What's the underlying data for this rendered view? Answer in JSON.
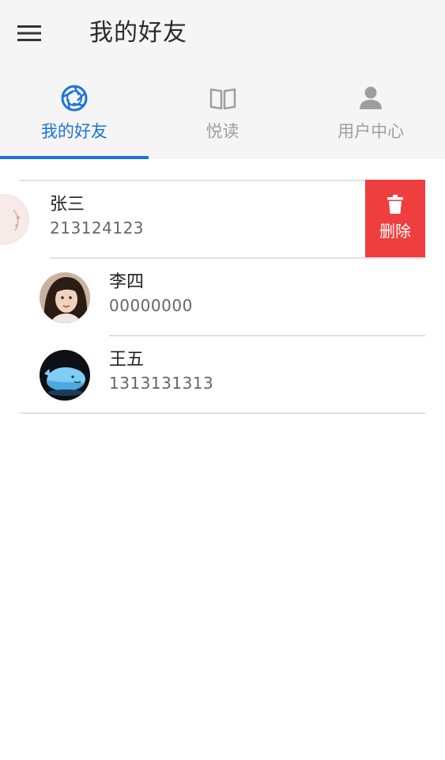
{
  "appbar": {
    "title": "我的好友",
    "menu_icon": "hamburger-menu-icon"
  },
  "tabs": [
    {
      "label": "我的好友",
      "icon": "aperture-icon",
      "active": true
    },
    {
      "label": "悦读",
      "icon": "book-icon",
      "active": false
    },
    {
      "label": "用户中心",
      "icon": "person-icon",
      "active": false
    }
  ],
  "friends": [
    {
      "name": "张三",
      "phone": "213124123",
      "swiped": true
    },
    {
      "name": "李四",
      "phone": "00000000",
      "swiped": false
    },
    {
      "name": "王五",
      "phone": "1313131313",
      "swiped": false
    }
  ],
  "swipe_action": {
    "label": "删除",
    "icon": "trash-icon",
    "color": "#ee3e3e"
  },
  "colors": {
    "accent": "#1e73d8",
    "inactive": "#9e9e9e",
    "bar_background": "#f5f5f5",
    "delete": "#ee3e3e"
  }
}
